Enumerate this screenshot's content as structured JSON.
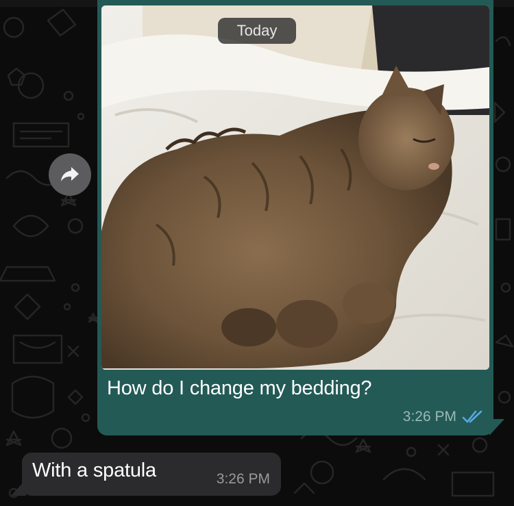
{
  "date_divider": "Today",
  "outgoing_message": {
    "caption": "How do I change my bedding?",
    "time": "3:26 PM",
    "status_icon": "double-check-read-icon",
    "photo_icon": "cat-photo"
  },
  "incoming_message": {
    "text": "With a spatula",
    "time": "3:26 PM"
  },
  "forward_icon": "forward-arrow-icon",
  "colors": {
    "outgoing_bubble": "#235a56",
    "incoming_bubble": "#2b2b2d",
    "read_ticks": "#5aa9e6",
    "background": "#0c0c0c"
  }
}
